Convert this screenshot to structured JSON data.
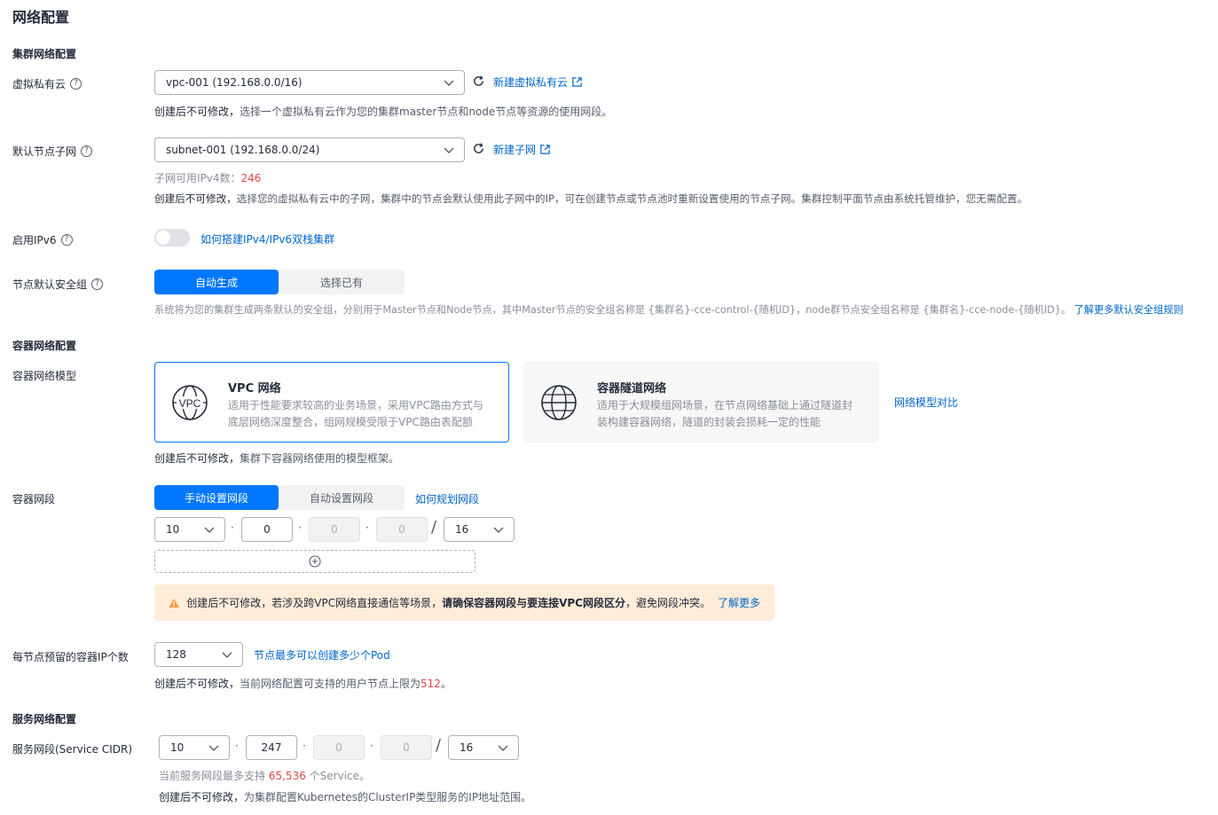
{
  "page_title": "网络配置",
  "cluster_network": {
    "section_title": "集群网络配置",
    "vpc": {
      "label": "虚拟私有云",
      "value": "vpc-001 (192.168.0.0/16)",
      "create_link": "新建虚拟私有云",
      "hint_prefix": "创建后不可修改，",
      "hint": "选择一个虚拟私有云作为您的集群master节点和node节点等资源的使用网段。"
    },
    "subnet": {
      "label": "默认节点子网",
      "value": "subnet-001 (192.168.0.0/24)",
      "create_link": "新建子网",
      "ipv4_label": "子网可用IPv4数：",
      "ipv4_count": "246",
      "hint_prefix": "创建后不可修改，",
      "hint": "选择您的虚拟私有云中的子网，集群中的节点会默认使用此子网中的IP，可在创建节点或节点池时重新设置使用的节点子网。集群控制平面节点由系统托管维护，您无需配置。"
    },
    "ipv6": {
      "label": "启用IPv6",
      "enabled": false,
      "link": "如何搭建IPv4/IPv6双栈集群"
    },
    "security_group": {
      "label": "节点默认安全组",
      "options": [
        "自动生成",
        "选择已有"
      ],
      "selected": "自动生成",
      "hint": "系统将为您的集群生成两条默认的安全组，分别用于Master节点和Node节点，其中Master节点的安全组名称是 {集群名}-cce-control-{随机ID}，node群节点安全组名称是 {集群名}-cce-node-{随机ID}。",
      "link": "了解更多默认安全组规则"
    }
  },
  "container_network": {
    "section_title": "容器网络配置",
    "model": {
      "label": "容器网络模型",
      "cards": [
        {
          "icon": "vpc-network-icon",
          "title": "VPC 网络",
          "desc1": "适用于性能要求较高的业务场景，采用VPC路由方式与",
          "desc2": "底层网络深度整合，组网规模受限于VPC路由表配额",
          "selected": true
        },
        {
          "icon": "globe-icon",
          "title": "容器隧道网络",
          "desc1": "适用于大规模组网场景，在节点网络基础上通过隧道封",
          "desc2": "装构建容器网络，隧道的封装会损耗一定的性能",
          "selected": false
        }
      ],
      "compare_link": "网络模型对比",
      "hint_prefix": "创建后不可修改，",
      "hint": "集群下容器网络使用的模型框架。"
    },
    "cidr": {
      "label": "容器网段",
      "options": [
        "手动设置网段",
        "自动设置网段"
      ],
      "selected": "手动设置网段",
      "plan_link": "如何规划网段",
      "octet1": "10",
      "octet2": "0",
      "octet3": "0",
      "octet4": "0",
      "mask": "16",
      "alert_text1": "创建后不可修改，若涉及跨VPC网络直接通信等场景，",
      "alert_bold": "请确保容器网段与要连接VPC网段区分",
      "alert_text2": "，避免网段冲突。",
      "alert_link": "了解更多"
    },
    "pod_ip": {
      "label": "每节点预留的容器IP个数",
      "value": "128",
      "link": "节点最多可以创建多少个Pod",
      "hint_prefix": "创建后不可修改，",
      "hint": "当前网络配置可支持的用户节点上限为",
      "limit": "512",
      "hint_suffix": "。"
    }
  },
  "service_network": {
    "section_title": "服务网络配置",
    "cidr": {
      "label": "服务网段(Service CIDR)",
      "octet1": "10",
      "octet2": "247",
      "octet3": "0",
      "octet4": "0",
      "mask": "16",
      "support_prefix": "当前服务网段最多支持",
      "support_count": "65,536",
      "support_suffix": "个Service。",
      "hint_prefix": "创建后不可修改，",
      "hint": "为集群配置Kubernetes的ClusterIP类型服务的IP地址范围。"
    }
  },
  "colors": {
    "primary": "#0077ff",
    "link": "#0066cc",
    "danger": "#e54545",
    "warning_bg": "#ffecd9",
    "warning_icon": "#fa9841"
  }
}
